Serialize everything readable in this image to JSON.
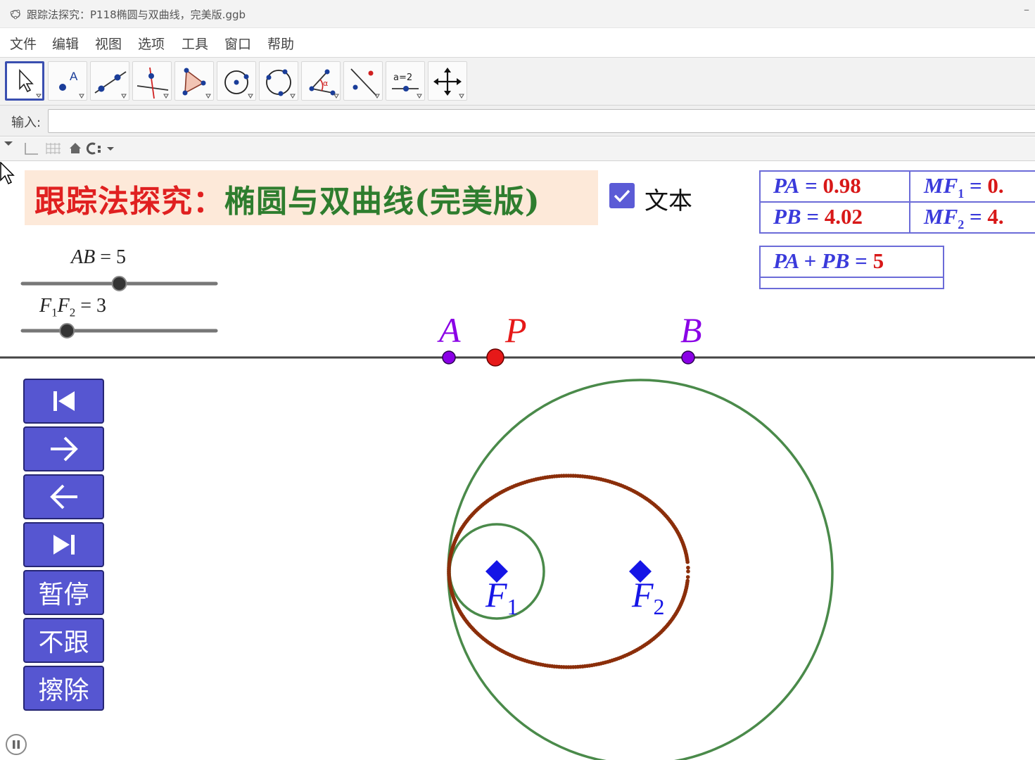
{
  "window": {
    "title": "跟踪法探究：P118椭圆与双曲线，完美版.ggb",
    "minimize_glyph": "–"
  },
  "menu": {
    "items": [
      "文件",
      "编辑",
      "视图",
      "选项",
      "工具",
      "窗口",
      "帮助"
    ]
  },
  "toolbar": {
    "tools": [
      {
        "name": "move-tool",
        "icon": "arrow-cursor-icon",
        "selected": true
      },
      {
        "name": "point-tool",
        "icon": "point-icon",
        "label": "A"
      },
      {
        "name": "line-tool",
        "icon": "line-through-points-icon"
      },
      {
        "name": "perpendicular-tool",
        "icon": "perpendicular-line-icon"
      },
      {
        "name": "polygon-tool",
        "icon": "polygon-icon"
      },
      {
        "name": "circle-tool",
        "icon": "circle-center-point-icon"
      },
      {
        "name": "circle-3pts-tool",
        "icon": "circle-three-points-icon"
      },
      {
        "name": "angle-tool",
        "icon": "angle-icon",
        "label": "α"
      },
      {
        "name": "reflect-tool",
        "icon": "reflect-line-icon"
      },
      {
        "name": "slider-tool",
        "icon": "slider-icon",
        "label": "a=2"
      },
      {
        "name": "move-view-tool",
        "icon": "move-graphics-view-icon"
      }
    ]
  },
  "input_bar": {
    "label": "输入:",
    "value": ""
  },
  "graphics": {
    "title": {
      "part1": "跟踪法探究：",
      "part2": "椭圆与双曲线(完美版)"
    },
    "checkbox": {
      "label": "文本",
      "checked": true
    },
    "sliders": [
      {
        "name": "AB",
        "value": 5,
        "min": 0,
        "max": 10,
        "fraction": 0.5
      },
      {
        "name": "F1F2",
        "value": 3,
        "min": 0,
        "max": 10,
        "fraction": 0.23
      }
    ],
    "slider_labels": {
      "ab_var": "AB",
      "ab_eq": " = 5",
      "f1": "F",
      "f1_sub": "1",
      "f2": "F",
      "f2_sub": "2",
      "f_eq": " = 3"
    },
    "values_table": {
      "pa_var": "PA",
      "pa_val": "0.98",
      "pb_var": "PB",
      "pb_val": "4.02",
      "mf1_var": "MF",
      "mf1_sub": "1",
      "mf1_val": "0.",
      "mf2_var": "MF",
      "mf2_sub": "2",
      "mf2_val": "4.",
      "eq": " = "
    },
    "sum": {
      "expr": "PA + PB",
      "eq": " = ",
      "val": "5"
    },
    "points": {
      "A": {
        "label": "A",
        "color": "#8a00e6"
      },
      "P": {
        "label": "P",
        "color": "#e61919"
      },
      "B": {
        "label": "B",
        "color": "#8a00e6"
      },
      "F1": {
        "label": "F",
        "sub": "1",
        "color": "#1515e6"
      },
      "F2": {
        "label": "F",
        "sub": "2",
        "color": "#1515e6"
      }
    },
    "buttons": [
      {
        "name": "first-step-button",
        "label": "",
        "icon": "skip-to-start-icon"
      },
      {
        "name": "step-forward-button",
        "label": "",
        "icon": "arrow-right-icon"
      },
      {
        "name": "step-back-button",
        "label": "",
        "icon": "arrow-left-icon"
      },
      {
        "name": "last-step-button",
        "label": "",
        "icon": "skip-to-end-icon"
      },
      {
        "name": "pause-animation-button",
        "label": "暂停"
      },
      {
        "name": "stop-trace-button",
        "label": "不跟"
      },
      {
        "name": "erase-trace-button",
        "label": "擦除"
      }
    ],
    "colors": {
      "circle": "#4a8a4a",
      "trace": "#8b2e0a",
      "line": "#444444",
      "button": "#5656d1",
      "table_border": "#6b6bd8",
      "value_red": "#d81818",
      "var_blue": "#3a3adb"
    }
  }
}
